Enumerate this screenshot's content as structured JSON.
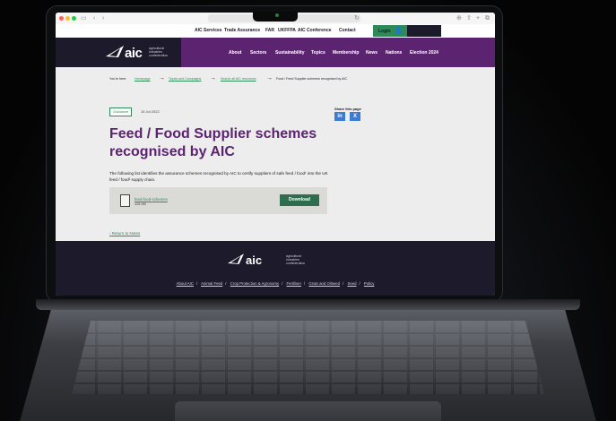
{
  "browser": {
    "icons": [
      "sidebar-icon",
      "back-icon",
      "forward-icon",
      "reload-icon",
      "download-icon",
      "share-icon",
      "new-tab-icon",
      "tabs-icon"
    ]
  },
  "topnav": {
    "links": [
      "AIC Services",
      "Trade Assurance",
      "FAR",
      "UKFFPA",
      "AIC Conference",
      "Contact"
    ],
    "login": "Login",
    "search": "Search"
  },
  "logo": {
    "text": "aic",
    "sub": "agricultural industries confederation"
  },
  "mainnav": {
    "items": [
      "About",
      "Sectors",
      "Sustainability",
      "Topics",
      "Membership",
      "News",
      "Nations",
      "Election 2024"
    ]
  },
  "breadcrumb": {
    "label": "You're here:",
    "items": [
      "Homepage",
      "Topics and Campaigns",
      "Search all AIC resources",
      "Food / Feed Supplier schemes recognised by AIC"
    ]
  },
  "page": {
    "tag": "Guidance",
    "date": "15 Jul 2022",
    "share_label": "Share this page",
    "share_linkedin": "in",
    "share_x": "X",
    "title": "Feed / Food Supplier schemes recognised by AIC",
    "intro": "The following list identifies the assurance schemes recognised by AIC to certify suppliers of safe feed / food¹ into the UK feed / food² supply chain.",
    "download_name": "feed-food-schemes",
    "download_size": "115 KB",
    "download_button": "Download",
    "back": "Return to Notes"
  },
  "footer": {
    "logo": "aic",
    "sub": "agricultural industries confederation",
    "links": [
      "About AIC",
      "Animal Feed",
      "Crop Protection & Agronomy",
      "Fertiliser",
      "Grain and Oilseed",
      "Seed",
      "Policy"
    ]
  },
  "colors": {
    "purple": "#5c2370",
    "navy": "#1c1a2b",
    "green": "#2e8a57"
  }
}
